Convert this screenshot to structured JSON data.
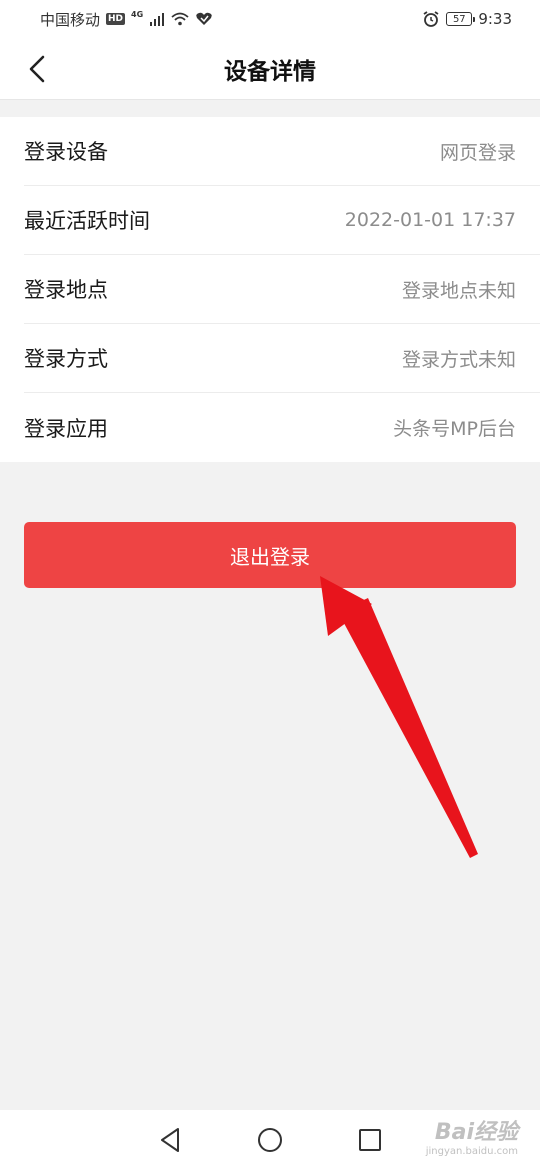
{
  "status_bar": {
    "carrier": "中国移动",
    "hd": "HD",
    "network": "4G",
    "battery": "57",
    "time": "9:33"
  },
  "header": {
    "title": "设备详情",
    "back_icon": "chevron-left-icon"
  },
  "info_rows": [
    {
      "label": "登录设备",
      "value": "网页登录"
    },
    {
      "label": "最近活跃时间",
      "value": "2022-01-01 17:37"
    },
    {
      "label": "登录地点",
      "value": "登录地点未知"
    },
    {
      "label": "登录方式",
      "value": "登录方式未知"
    },
    {
      "label": "登录应用",
      "value": "头条号MP后台"
    }
  ],
  "logout_button": {
    "label": "退出登录"
  },
  "nav_bar": {
    "back_icon": "triangle-back-icon",
    "home_icon": "circle-home-icon",
    "recents_icon": "square-recents-icon"
  },
  "watermark": {
    "main": "Bai经验",
    "sub": "jingyan.baidu.com"
  },
  "colors": {
    "accent": "#ee4444",
    "background": "#f2f2f2",
    "annotation_arrow": "#e8141c"
  }
}
